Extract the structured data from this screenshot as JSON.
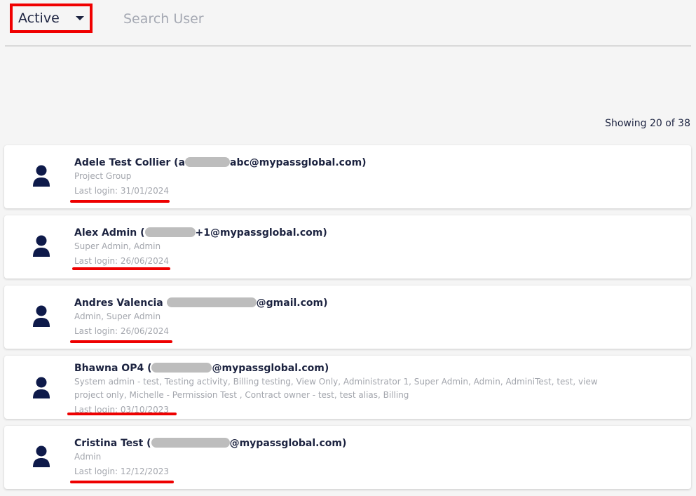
{
  "filter": {
    "status_value": "Active",
    "search_placeholder": "Search User"
  },
  "results": {
    "showing_text": "Showing 20 of 38"
  },
  "users": [
    {
      "name_prefix": "Adele Test Collier (a",
      "name_suffix": "abc@mypassglobal.com)",
      "roles": "Project Group",
      "last_login": "Last login: 31/01/2024"
    },
    {
      "name_prefix": "Alex Admin (",
      "name_suffix": "+1@mypassglobal.com)",
      "roles": "Super Admin, Admin",
      "last_login": "Last login: 26/06/2024"
    },
    {
      "name_prefix": "Andres Valencia ",
      "name_suffix": "@gmail.com)",
      "roles": "Admin, Super Admin",
      "last_login": "Last login: 26/06/2024"
    },
    {
      "name_prefix": "Bhawna OP4 (",
      "name_suffix": "@mypassglobal.com)",
      "roles": "System admin - test, Testing activity, Billing testing, View Only, Administrator 1, Super Admin, Admin, AdminiTest, test, view project only, Michelle - Permission Test , Contract owner - test, test alias, Billing",
      "last_login": "Last login: 03/10/2023"
    },
    {
      "name_prefix": "Cristina Test (",
      "name_suffix": "@mypassglobal.com)",
      "roles": "Admin",
      "last_login": "Last login: 12/12/2023"
    }
  ],
  "colors": {
    "annotation_red": "#ee0000",
    "text_dark": "#1c2340",
    "text_muted": "#a3a6ad"
  }
}
